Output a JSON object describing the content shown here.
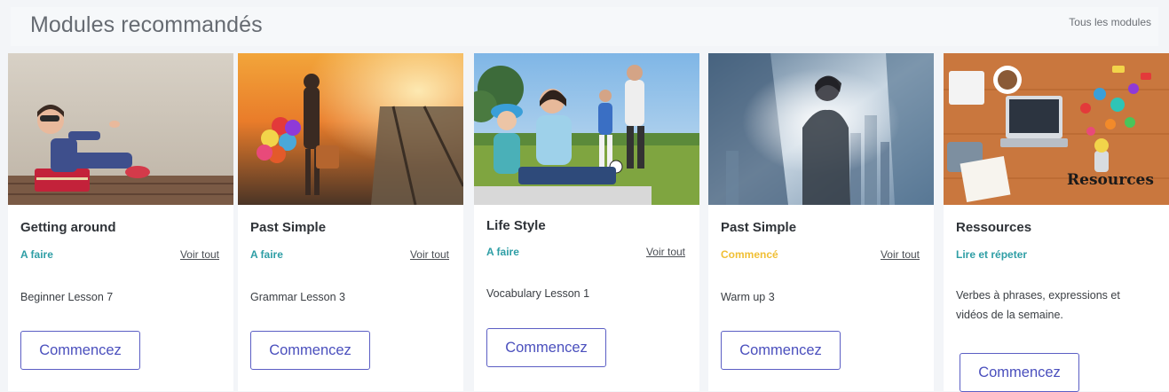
{
  "header": {
    "title": "Modules recommandés",
    "all_modules_label": "Tous les modules"
  },
  "cards": [
    {
      "title": "Getting around",
      "status": "A faire",
      "status_color": "#2e9ea5",
      "view_all": "Voir tout",
      "description": "Beginner Lesson 7",
      "button": "Commencez"
    },
    {
      "title": "Past Simple",
      "status": "A faire",
      "status_color": "#2e9ea5",
      "view_all": "Voir tout",
      "description": "Grammar Lesson 3",
      "button": "Commencez"
    },
    {
      "title": "Life Style",
      "status": "A faire",
      "status_color": "#2e9ea5",
      "view_all": "Voir tout",
      "description": "Vocabulary Lesson 1",
      "button": "Commencez"
    },
    {
      "title": "Past Simple",
      "status": "Commencé",
      "status_color": "#f0bf34",
      "view_all": "Voir tout",
      "description": "Warm up 3",
      "button": "Commencez"
    },
    {
      "title": "Ressources",
      "status": "Lire et répeter",
      "status_color": "#2e9ea5",
      "description": "Verbes à phrases, expressions et vidéos de la semaine.",
      "image_caption": "Resources",
      "button": "Commencez"
    }
  ]
}
